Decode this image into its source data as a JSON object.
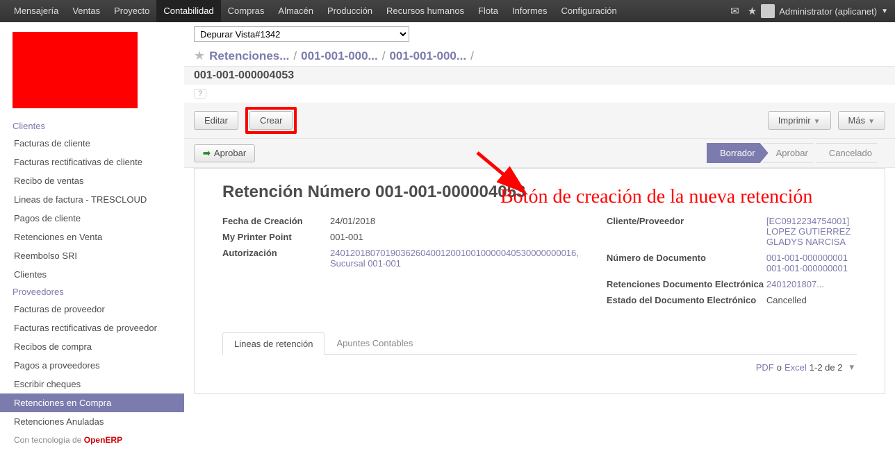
{
  "topbar": {
    "menus": [
      "Mensajería",
      "Ventas",
      "Proyecto",
      "Contabilidad",
      "Compras",
      "Almacén",
      "Producción",
      "Recursos humanos",
      "Flota",
      "Informes",
      "Configuración"
    ],
    "active_index": 3,
    "user": "Administrator (aplicanet)"
  },
  "sidebar": {
    "section1": {
      "title": "Clientes",
      "items": [
        "Facturas de cliente",
        "Facturas rectificativas de cliente",
        "Recibo de ventas",
        "Lineas de factura - TRESCLOUD",
        "Pagos de cliente",
        "Retenciones en Venta",
        "Reembolso SRI",
        "Clientes"
      ]
    },
    "section2": {
      "title": "Proveedores",
      "items": [
        "Facturas de proveedor",
        "Facturas rectificativas de proveedor",
        "Recibos de compra",
        "Pagos a proveedores",
        "Escribir cheques",
        "Retenciones en Compra",
        "Retenciones Anuladas"
      ],
      "active_index": 5
    },
    "footer_prefix": "Con tecnología de ",
    "footer_brand": "OpenERP"
  },
  "debug_view": "Depurar Vista#1342",
  "breadcrumbs": [
    "Retenciones...",
    "001-001-000...",
    "001-001-000..."
  ],
  "subtitle": "001-001-000004053",
  "toolbar": {
    "edit": "Editar",
    "create": "Crear",
    "print": "Imprimir",
    "more": "Más"
  },
  "statusbar": {
    "approve": "Aprobar",
    "steps": [
      "Borrador",
      "Aprobar",
      "Cancelado"
    ],
    "active": 0
  },
  "annotation": "Botón de creación de la nueva retención",
  "form": {
    "title_label": "Retención Número ",
    "doc_number": "001-001-000004053",
    "left": [
      {
        "label": "Fecha de Creación",
        "value": "24/01/2018"
      },
      {
        "label": "My Printer Point",
        "value": "001-001"
      },
      {
        "label": "Autorización",
        "value": "2401201807019036260400120010010000040530000000016, Sucursal 001-001",
        "link": true
      }
    ],
    "right": [
      {
        "label": "Cliente/Proveedor",
        "value": "[EC0912234754001] LOPEZ GUTIERREZ GLADYS NARCISA",
        "link": true
      },
      {
        "label": "Número de Documento",
        "value": "001-001-000000001\n001-001-000000001",
        "link": true
      },
      {
        "label": "Retenciones Documento Electrónica",
        "value": "2401201807...",
        "link": true
      },
      {
        "label": "Estado del Documento Electrónico",
        "value": "Cancelled"
      }
    ],
    "tabs": [
      "Lineas de retención",
      "Apuntes Contables"
    ],
    "tab_active": 0,
    "footer": {
      "pdf": "PDF",
      "or": "o",
      "excel": "Excel",
      "range": "1-2 de 2"
    }
  }
}
